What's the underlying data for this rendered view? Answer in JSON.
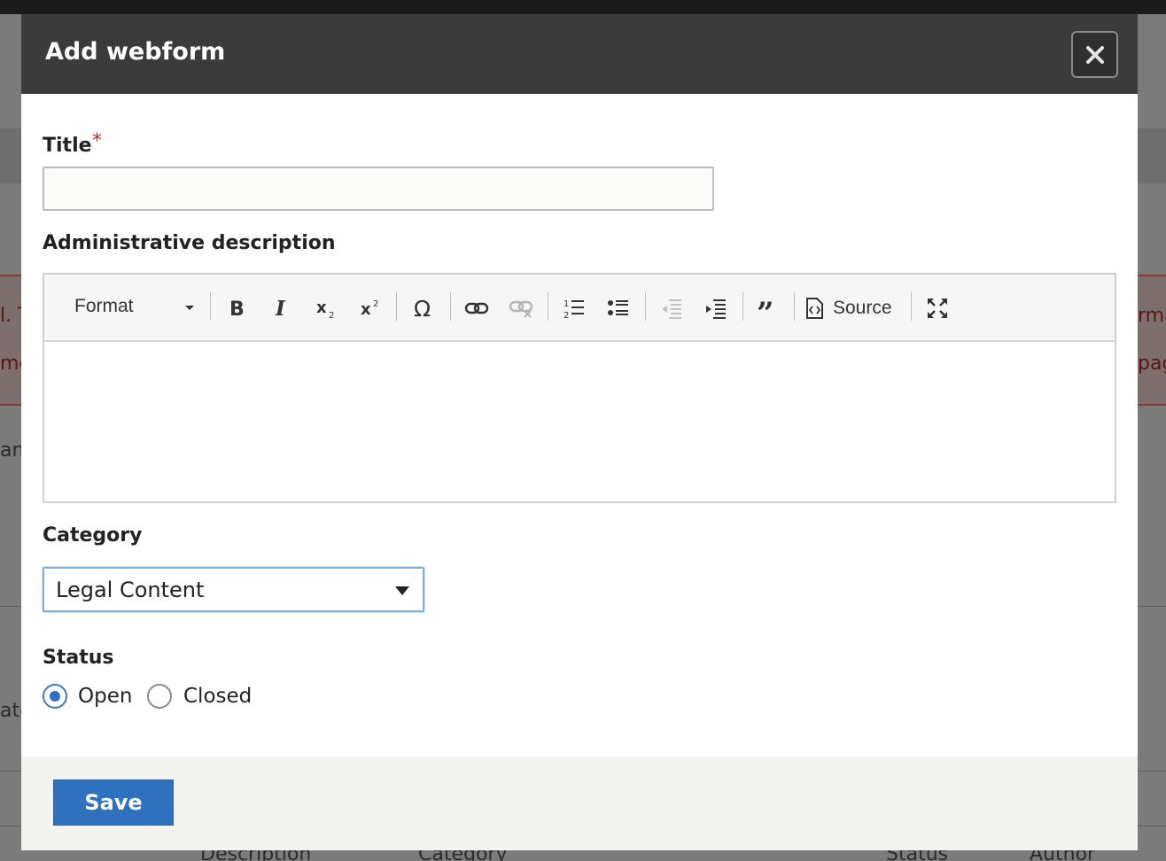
{
  "dialog": {
    "title": "Add webform",
    "close_icon": "close-icon"
  },
  "form": {
    "title_label": "Title",
    "required_marker": "*",
    "title_value": "",
    "description_label": "Administrative description",
    "category_label": "Category",
    "category_value": "Legal Content",
    "status_label": "Status",
    "status_options": [
      {
        "label": "Open",
        "checked": true
      },
      {
        "label": "Closed",
        "checked": false
      }
    ]
  },
  "editor_toolbar": {
    "format_label": "Format",
    "source_label": "Source",
    "icons": [
      "bold-icon",
      "italic-icon",
      "subscript-icon",
      "superscript-icon",
      "special-character-icon",
      "link-icon",
      "unlink-icon",
      "numbered-list-icon",
      "bulleted-list-icon",
      "outdent-icon",
      "indent-icon",
      "blockquote-icon",
      "source-icon",
      "maximize-icon"
    ]
  },
  "footer": {
    "save_label": "Save"
  },
  "background": {
    "fragments": [
      "l. T",
      "rma",
      "me",
      "pag",
      "an",
      "ate"
    ],
    "table_headers": [
      "Description",
      "Category",
      "Status",
      "Author"
    ]
  },
  "colors": {
    "titlebar": "#3b3b3b",
    "primary_button": "#2f71bf",
    "required": "#c2281f",
    "focus_border": "#7fb0dd"
  }
}
